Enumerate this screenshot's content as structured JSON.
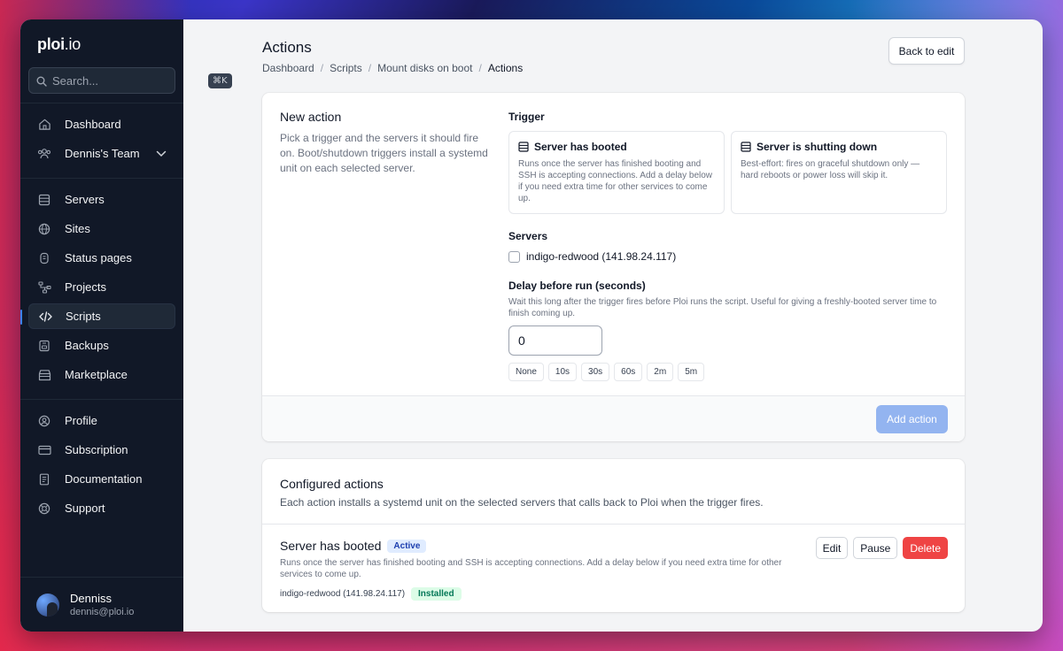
{
  "app": {
    "logo_main": "ploi",
    "logo_suffix": ".io"
  },
  "search": {
    "placeholder": "Search...",
    "shortcut": "⌘K"
  },
  "sidebar": {
    "items": [
      {
        "label": "Dashboard",
        "icon": "home-icon"
      },
      {
        "label": "Dennis's Team",
        "icon": "team-icon"
      },
      {
        "label": "Servers",
        "icon": "server-icon"
      },
      {
        "label": "Sites",
        "icon": "globe-icon"
      },
      {
        "label": "Status pages",
        "icon": "status-icon"
      },
      {
        "label": "Projects",
        "icon": "projects-icon"
      },
      {
        "label": "Scripts",
        "icon": "code-icon"
      },
      {
        "label": "Backups",
        "icon": "backup-icon"
      },
      {
        "label": "Marketplace",
        "icon": "store-icon"
      },
      {
        "label": "Profile",
        "icon": "profile-icon"
      },
      {
        "label": "Subscription",
        "icon": "card-icon"
      },
      {
        "label": "Documentation",
        "icon": "doc-icon"
      },
      {
        "label": "Support",
        "icon": "support-icon"
      }
    ],
    "active": "Scripts"
  },
  "user": {
    "name": "Denniss",
    "email": "dennis@ploi.io"
  },
  "page": {
    "title": "Actions",
    "back_label": "Back to edit",
    "breadcrumb": [
      "Dashboard",
      "Scripts",
      "Mount disks on boot",
      "Actions"
    ]
  },
  "new_action": {
    "title": "New action",
    "description": "Pick a trigger and the servers it should fire on. Boot/shutdown triggers install a systemd unit on each selected server.",
    "trigger_label": "Trigger",
    "triggers": [
      {
        "title": "Server has booted",
        "description": "Runs once the server has finished booting and SSH is accepting connections. Add a delay below if you need extra time for other services to come up."
      },
      {
        "title": "Server is shutting down",
        "description": "Best-effort: fires on graceful shutdown only — hard reboots or power loss will skip it."
      }
    ],
    "servers_label": "Servers",
    "server_option": "indigo-redwood (141.98.24.117)",
    "delay_label": "Delay before run (seconds)",
    "delay_description": "Wait this long after the trigger fires before Ploi runs the script. Useful for giving a freshly-booted server time to finish coming up.",
    "delay_value": "0",
    "presets": [
      "None",
      "10s",
      "30s",
      "60s",
      "2m",
      "5m"
    ],
    "submit_label": "Add action"
  },
  "configured": {
    "title": "Configured actions",
    "description": "Each action installs a systemd unit on the selected servers that calls back to Ploi when the trigger fires.",
    "action": {
      "title": "Server has booted",
      "status": "Active",
      "description": "Runs once the server has finished booting and SSH is accepting connections. Add a delay below if you need extra time for other services to come up.",
      "server": "indigo-redwood (141.98.24.117)",
      "server_status": "Installed",
      "edit_label": "Edit",
      "pause_label": "Pause",
      "delete_label": "Delete"
    }
  },
  "colors": {
    "sidebar_bg": "#111827",
    "accent": "#3b82f6",
    "danger": "#ef4444",
    "disabled_primary": "#93b4f0"
  }
}
